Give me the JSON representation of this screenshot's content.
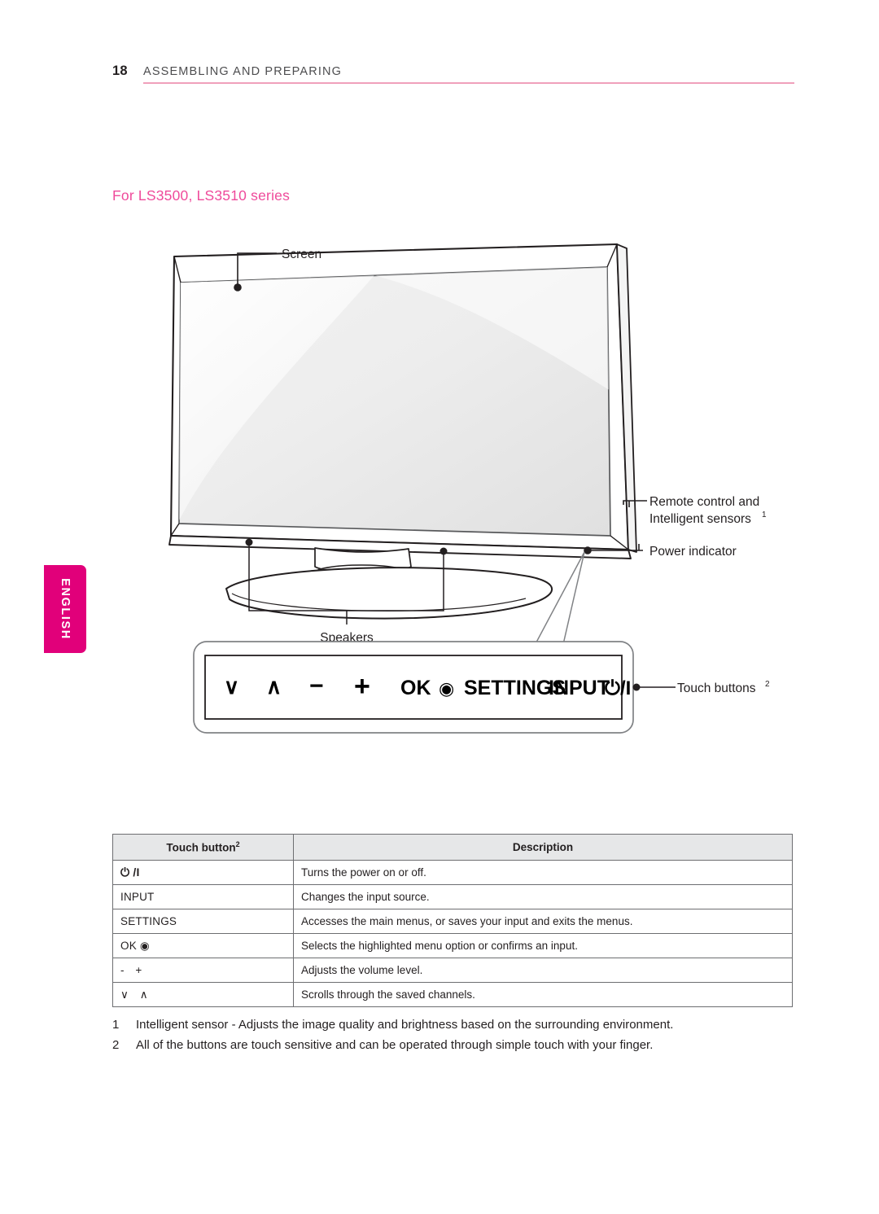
{
  "header": {
    "page_number": "18",
    "title": "ASSEMBLING AND PREPARING",
    "rule_color": "#f0a0bb"
  },
  "side_tab": {
    "label": "ENGLISH",
    "background": "#e1007a",
    "text_color": "#ffffff"
  },
  "section": {
    "heading": "For LS3500, LS3510 series",
    "heading_color": "#ef4a9b"
  },
  "figure": {
    "callouts": {
      "screen": "Screen",
      "remote_line1": "Remote control and",
      "remote_line2": "Intelligent sensors",
      "remote_sup": "1",
      "power_indicator": "Power indicator",
      "speakers": "Speakers",
      "touch_buttons": "Touch buttons",
      "touch_buttons_sup": "2"
    },
    "touch_panel_buttons": [
      {
        "name": "channel-down-icon",
        "glyph": "∨"
      },
      {
        "name": "channel-up-icon",
        "glyph": "∧"
      },
      {
        "name": "volume-down-icon",
        "glyph": "−"
      },
      {
        "name": "volume-up-icon",
        "glyph": "+"
      },
      {
        "name": "ok-button",
        "glyph": "OK"
      },
      {
        "name": "ok-dot-icon",
        "glyph": "◉"
      },
      {
        "name": "settings-button",
        "glyph": "SETTINGS"
      },
      {
        "name": "input-button",
        "glyph": "INPUT"
      },
      {
        "name": "power-button",
        "glyph": "⏻/I"
      }
    ]
  },
  "table": {
    "headers": {
      "button": "Touch button",
      "button_sup": "2",
      "description": "Description"
    },
    "rows": [
      {
        "button": "⏻ /I",
        "bold": true,
        "description": "Turns the power on or off."
      },
      {
        "button": "INPUT",
        "bold": false,
        "description": "Changes the input source."
      },
      {
        "button": "SETTINGS",
        "bold": false,
        "description": "Accesses the main menus, or saves your input and exits the menus."
      },
      {
        "button": "OK ◉",
        "bold": false,
        "description": "Selects the highlighted menu option or confirms an input."
      },
      {
        "button": "- +",
        "bold": false,
        "description": "Adjusts the volume level."
      },
      {
        "button": "∨ ∧",
        "bold": false,
        "description": "Scrolls through the saved channels."
      }
    ]
  },
  "footnotes": [
    {
      "num": "1",
      "text": "Intelligent sensor - Adjusts the image quality and brightness based on the surrounding environment."
    },
    {
      "num": "2",
      "text": "All of the buttons are touch sensitive and can be operated through simple touch with your finger."
    }
  ]
}
